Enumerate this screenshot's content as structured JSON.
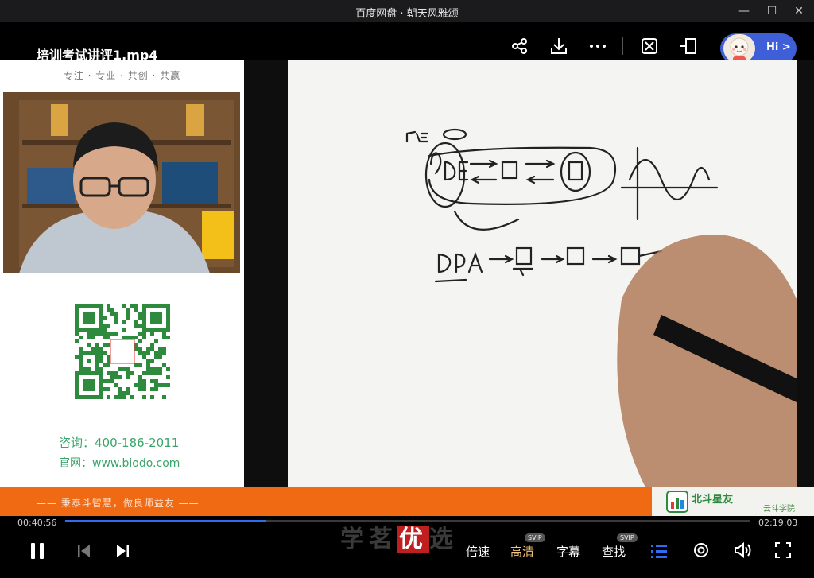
{
  "window": {
    "title": "百度网盘 · 朝天风雅颂"
  },
  "player": {
    "filename": "培训考试讲评1.mp4",
    "hi_label": "Hi >"
  },
  "left_panel": {
    "slogan": "—— 专注 · 专业 · 共创 · 共赢 ——",
    "consult": "咨询：400-186-2011",
    "site": "官网：www.biodo.com"
  },
  "banner": {
    "text": "—— 秉泰斗智慧，做良师益友 ——",
    "brand": "北斗星友",
    "brand_sub": "云斗学院"
  },
  "progress": {
    "current": "00:40:56",
    "total": "02:19:03",
    "fraction": 0.294
  },
  "controls": {
    "speed": "倍速",
    "quality": "高清",
    "subtitle": "字幕",
    "find": "查找",
    "svip": "SVIP",
    "watermark_a": "学",
    "watermark_b": "茗",
    "watermark_c": "优",
    "watermark_d": "选"
  },
  "colors": {
    "accent": "#2f6cf0",
    "banner": "#f06a14",
    "green": "#3aa56a"
  }
}
